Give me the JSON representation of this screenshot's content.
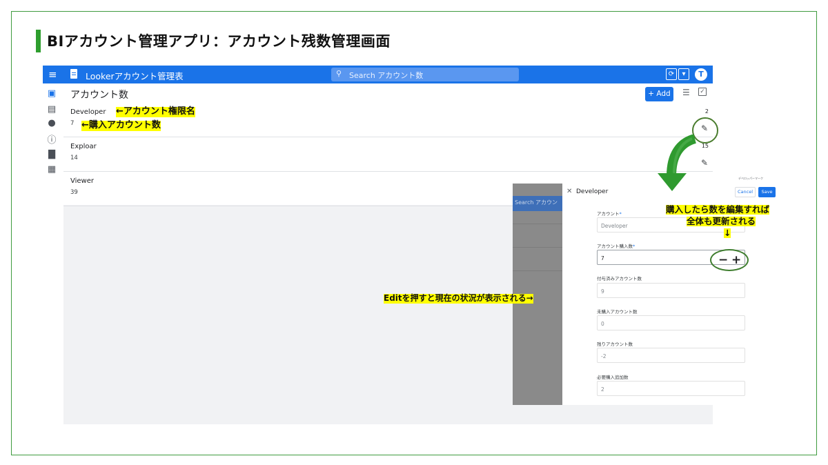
{
  "slide": {
    "title": "BIアカウント管理アプリ：アカウント残数管理画面"
  },
  "app": {
    "title": "Lookerアカウント管理表",
    "search_placeholder": "Search アカウント数",
    "avatar_letter": "T",
    "sync_icon": "⟳",
    "dropdown_icon": "▾"
  },
  "list": {
    "title": "アカウント数",
    "add_label": "Add",
    "rows": [
      {
        "name": "Developer",
        "value": "7",
        "count": "2"
      },
      {
        "name": "Exploar",
        "value": "14",
        "count": "15"
      },
      {
        "name": "Viewer",
        "value": "39",
        "count": ""
      }
    ]
  },
  "panel": {
    "title": "Developer",
    "cancel_label": "Cancel",
    "save_label": "Save",
    "small_label": "デベロッパーマーク",
    "fields": [
      {
        "label": "アカウント",
        "required": true,
        "value": "Developer"
      },
      {
        "label": "アカウント購入数",
        "required": true,
        "value": "7"
      },
      {
        "label": "付与済みアカウント数",
        "required": false,
        "value": "9"
      },
      {
        "label": "未購入アカウント数",
        "required": false,
        "value": "0"
      },
      {
        "label": "残りアカウント数",
        "required": false,
        "value": "-2"
      },
      {
        "label": "必要購入追加数",
        "required": false,
        "value": "2"
      }
    ],
    "dimmed_search": "Search アカウン"
  },
  "annotations": {
    "role_note": "←アカウント権限名",
    "count_note": "←購入アカウント数",
    "edit_note": "Editを押すと現在の状況が表示される→",
    "update_note_line1": "購入したら数を編集すれば",
    "update_note_line2": "全体も更新される",
    "down_arrow": "↓"
  },
  "colors": {
    "accent": "#1a73e8",
    "highlight": "#ffff00",
    "frame_green": "#3e9b3e",
    "arrow_green": "#2f9a2f"
  }
}
